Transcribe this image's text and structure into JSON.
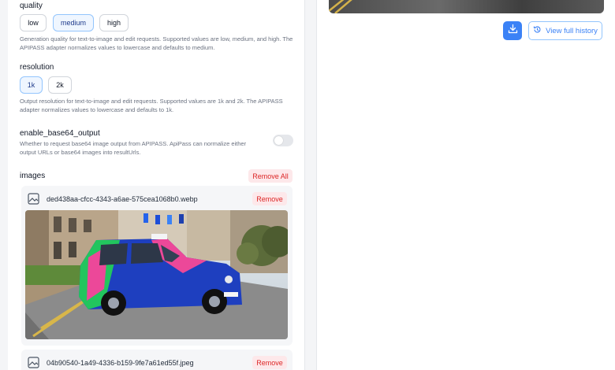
{
  "quality": {
    "label": "quality",
    "options": [
      "low",
      "medium",
      "high"
    ],
    "selected": "medium",
    "help": "Generation quality for text-to-image and edit requests. Supported values are low, medium, and high. The APIPASS adapter normalizes values to lowercase and defaults to medium."
  },
  "resolution": {
    "label": "resolution",
    "options": [
      "1k",
      "2k"
    ],
    "selected": "1k",
    "help": "Output resolution for text-to-image and edit requests. Supported values are 1k and 2k. The APIPASS adapter normalizes values to lowercase and defaults to 1k."
  },
  "base64": {
    "label": "enable_base64_output",
    "help": "Whether to request base64 image output from APIPASS. ApiPass can normalize either output URLs or base64 images into resultUrls.",
    "enabled": false
  },
  "images": {
    "label": "images",
    "remove_all_label": "Remove All",
    "remove_label": "Remove",
    "files": [
      {
        "name": "ded438aa-cfcc-4343-a6ae-575cea1068b0.webp"
      },
      {
        "name": "04b90540-1a49-4336-b159-9fe7a61ed55f.jpeg"
      }
    ]
  },
  "right": {
    "history_label": "View full history",
    "download_icon": "download-icon",
    "history_icon": "history-icon"
  },
  "colors": {
    "accent": "#3b82f6",
    "danger": "#dc2626",
    "danger_bg": "#fde8ea"
  }
}
